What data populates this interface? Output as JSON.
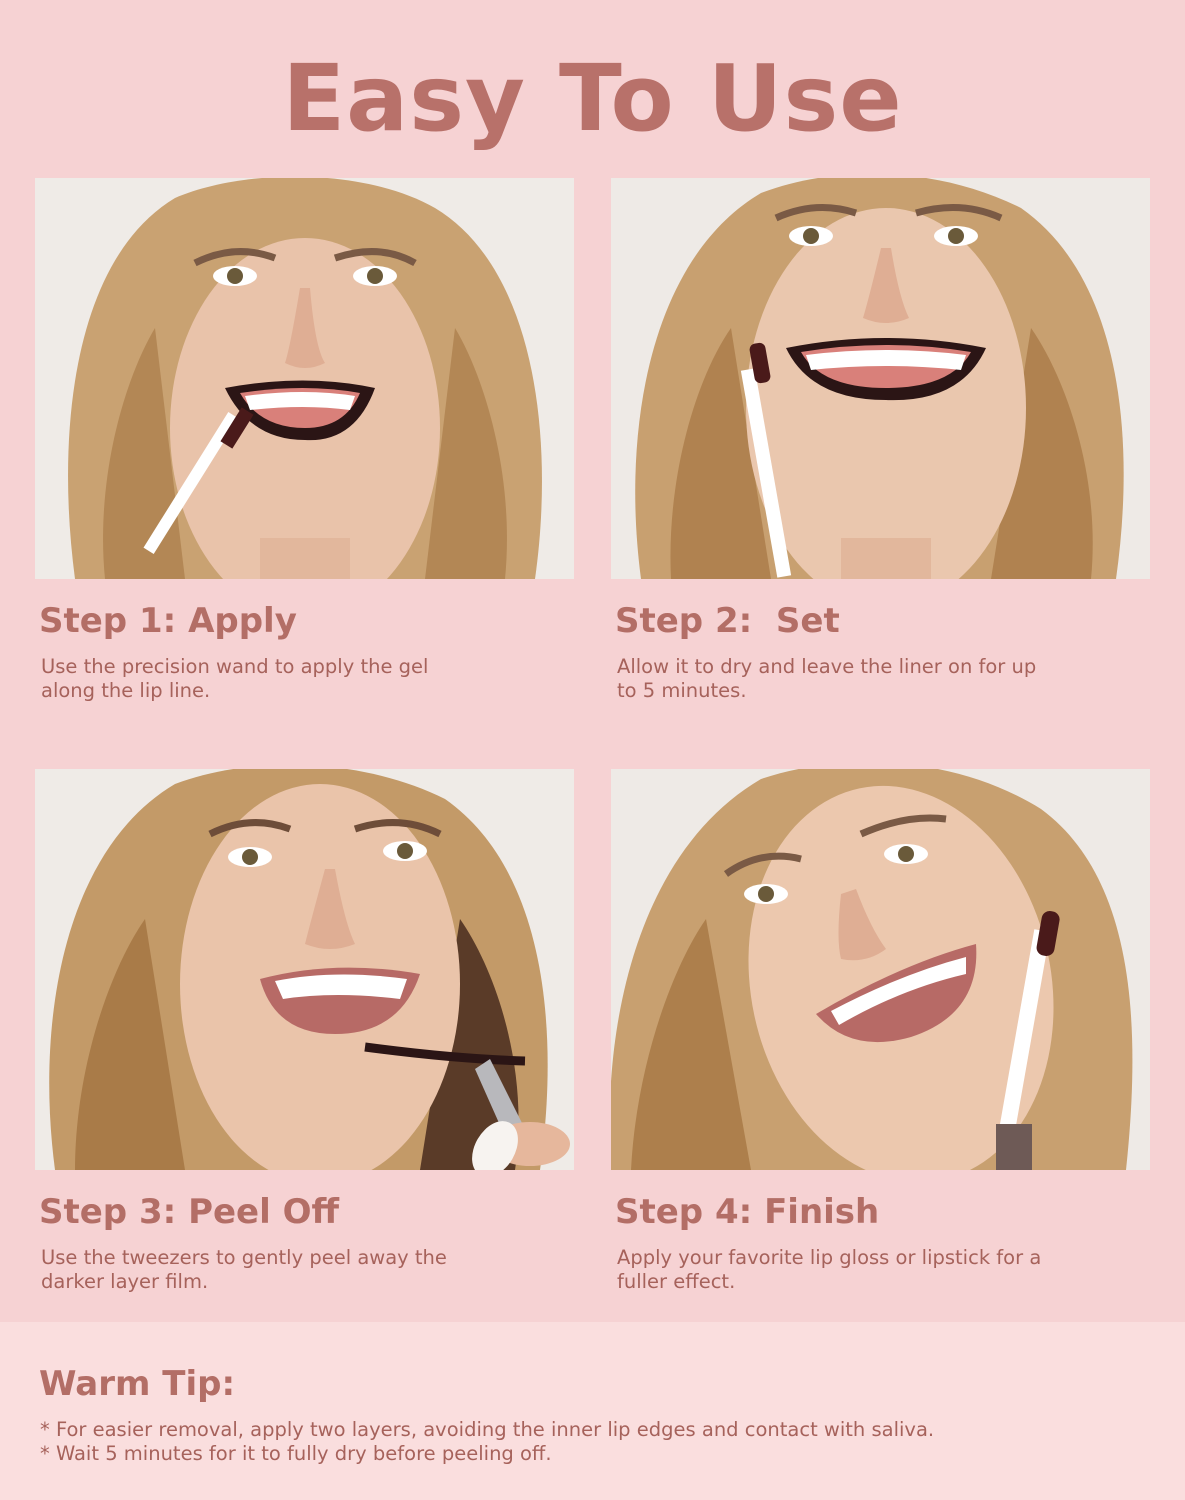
{
  "title": "Easy To Use",
  "steps": [
    {
      "title": "Step 1: Apply",
      "desc": "Use the precision wand to apply the gel along the lip line."
    },
    {
      "title": "Step 2:  Set",
      "desc": "Allow it to dry and leave the liner on for up to 5 minutes."
    },
    {
      "title": "Step 3: Peel Off",
      "desc": "Use the tweezers to gently peel away the darker layer film."
    },
    {
      "title": "Step 4: Finish",
      "desc": "Apply your favorite lip gloss or lipstick for a fuller effect."
    }
  ],
  "tip": {
    "title": "Warm Tip:",
    "lines": [
      "* For easier removal, apply two layers, avoiding the inner lip edges and contact with saliva.",
      "* Wait 5 minutes for it to fully dry before peeling off."
    ]
  },
  "colors": {
    "background": "#f6d2d3",
    "tip_background": "#fadede",
    "accent": "#b8716a",
    "text": "#a6625b"
  }
}
